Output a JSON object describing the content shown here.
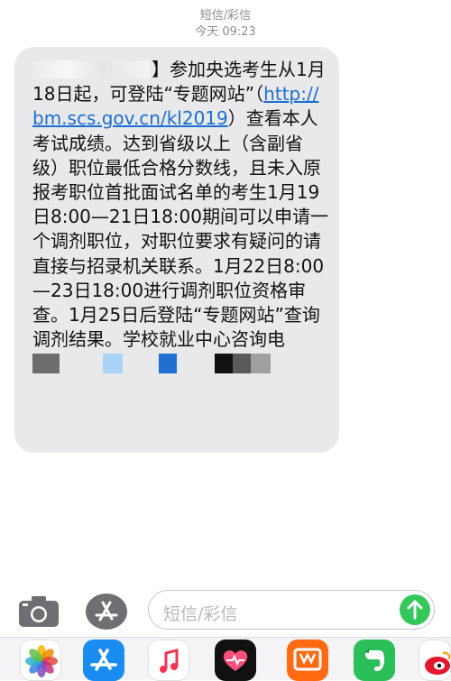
{
  "header": {
    "sender": "短信/彩信",
    "time": "今天 09:23"
  },
  "message": {
    "head_visible": "】参加央选考生从1月18日起，可登陆“专题网站”（",
    "link": "http://bm.scs.gov.cn/kl2019",
    "body": "）查看本人考试成绩。达到省级以上（含副省级）职位最低合格分数线，且未入原报考职位首批面试名单的考生1月19日8:00—21日18:00期间可以申请一个调剂职位，对职位要求有疑问的请直接与招录机关联系。1月22日8:00—23日18:00进行调剂职位资格审查。1月25日后登陆“专题网站”查询调剂结果。学校就业中心咨询电"
  },
  "composer": {
    "placeholder": "短信/彩信"
  },
  "icons": {
    "camera": "camera-icon",
    "apps": "app-store-icon",
    "send": "arrow-up-icon"
  },
  "dock": [
    "photos-icon",
    "app-store-icon",
    "music-icon",
    "heart-app-icon",
    "orange-app-icon",
    "evernote-icon",
    "weibo-icon"
  ],
  "colors": {
    "bubble": "#e9e9eb",
    "link": "#1a6fd1",
    "send": "#34c759"
  }
}
